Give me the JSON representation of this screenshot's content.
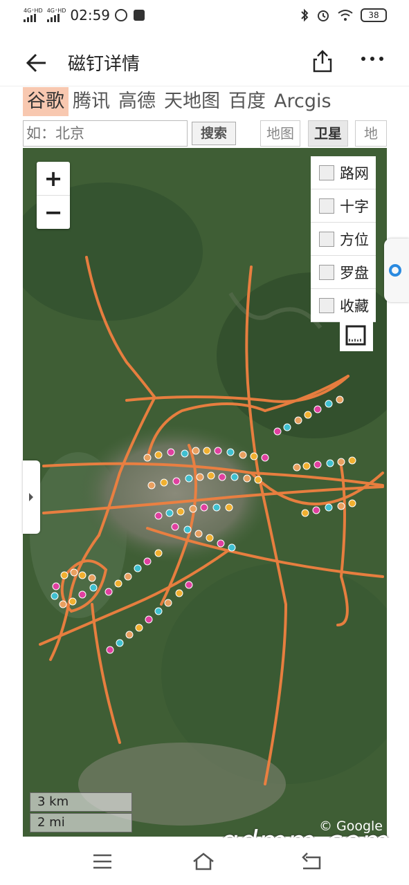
{
  "status": {
    "network1": "4G⁺HD",
    "network2": "4G⁺HD",
    "time": "02:59",
    "battery": "38"
  },
  "header": {
    "title": "磁钉详情"
  },
  "providers": [
    "谷歌",
    "腾讯",
    "高德",
    "天地图",
    "百度",
    "Arcgis"
  ],
  "search": {
    "placeholder": "如：北京",
    "button": "搜索"
  },
  "map_types": [
    "地图",
    "卫星",
    "地"
  ],
  "zoom": {
    "in": "+",
    "out": "−"
  },
  "layers": [
    "路网",
    "十字",
    "方位",
    "罗盘",
    "收藏"
  ],
  "scale": {
    "km": "3 km",
    "mi": "2 mi"
  },
  "copyright": "© Google",
  "watermark": "gdmm.com",
  "colors": {
    "road": "#f08040",
    "active_tab": "#f8c8b0"
  }
}
